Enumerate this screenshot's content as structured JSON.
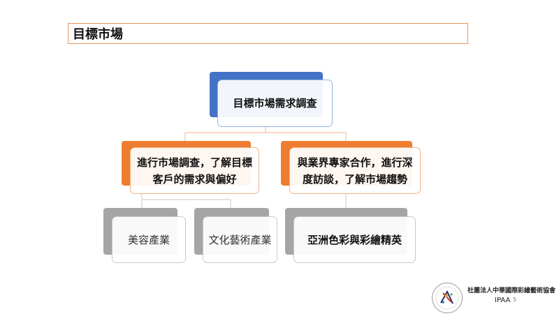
{
  "slide": {
    "title": "目標市場",
    "page_number": "5"
  },
  "diagram": {
    "root": {
      "label": "目標市場需求調查"
    },
    "branches": [
      {
        "label_line1": "進行市場調查，了解目標",
        "label_line2": "客戶的需求與偏好",
        "children": [
          {
            "label": "美容產業"
          },
          {
            "label": "文化藝術產業"
          }
        ]
      },
      {
        "label_line1": "與業界專家合作，進行深",
        "label_line2": "度訪談，了解市場趨勢",
        "children": [
          {
            "label": "亞洲色彩與彩繪精英"
          }
        ]
      }
    ],
    "colors": {
      "root_accent": "#4472c4",
      "root_border": "#8eb4e3",
      "level2_accent": "#ed7d31",
      "level2_border": "#f4b183",
      "level3_accent": "#a5a5a5",
      "level3_border": "#c9c9c9"
    }
  },
  "logo": {
    "org_name": "社團法人中華國際彩繪藝術協會",
    "abbr": "IPAA"
  }
}
